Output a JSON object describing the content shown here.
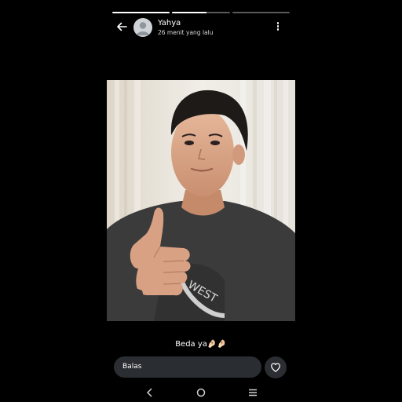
{
  "story": {
    "progress": [
      1,
      0.6,
      0
    ],
    "user_name": "Yahya",
    "timestamp": "26 menit yang lalu",
    "caption": "Beda ya🤌🏻🤌🏻",
    "reply_placeholder": "Balas"
  },
  "icons": {
    "back": "arrow-left-icon",
    "more": "more-vertical-icon",
    "like": "heart-icon",
    "nav_back": "chevron-left-icon",
    "nav_home": "circle-home-icon",
    "nav_recent": "menu-lines-icon"
  },
  "colors": {
    "background": "#000000",
    "input_bg": "#2a2d31"
  }
}
